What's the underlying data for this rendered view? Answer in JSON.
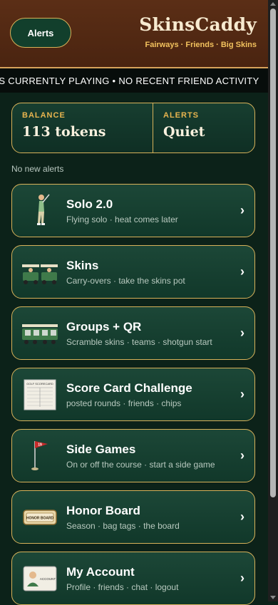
{
  "header": {
    "alerts_button": "Alerts",
    "title": "SkinsCaddy",
    "subtitle": "Fairways · Friends · Big Skins"
  },
  "ticker": {
    "text": "OS CURRENTLY PLAYING • NO RECENT FRIEND ACTIVITY"
  },
  "status": {
    "balance_label": "BALANCE",
    "balance_value": "113 tokens",
    "alerts_label": "ALERTS",
    "alerts_value": "Quiet"
  },
  "alerts_note": "No new alerts",
  "menu": [
    {
      "title": "Solo 2.0",
      "subtitle": "Flying solo · heat comes later",
      "icon": "golfer-icon"
    },
    {
      "title": "Skins",
      "subtitle": "Carry-overs · take the skins pot",
      "icon": "golf-carts-icon"
    },
    {
      "title": "Groups + QR",
      "subtitle": "Scramble skins · teams · shotgun start",
      "icon": "cart-fleet-icon"
    },
    {
      "title": "Score Card Challenge",
      "subtitle": "posted rounds · friends · chips",
      "icon": "scorecard-icon"
    },
    {
      "title": "Side Games",
      "subtitle": "On or off the course · start a side game",
      "icon": "flag-pin-icon"
    },
    {
      "title": "Honor Board",
      "subtitle": "Season · bag tags · the board",
      "icon": "honor-plaque-icon"
    },
    {
      "title": "My Account",
      "subtitle": "Profile · friends · chat · logout",
      "icon": "account-card-icon"
    }
  ],
  "chevron": "›",
  "icon_label_scorecard": "GOLF SCORECARD",
  "icon_label_flag": "19",
  "icon_label_honor": "HONOR BOARD",
  "icon_label_account": "ACCOUNT",
  "colors": {
    "accent_gold": "#d8b25a",
    "header_brown": "#5b2e16",
    "card_green": "#1c4737",
    "background": "#0c2219"
  }
}
